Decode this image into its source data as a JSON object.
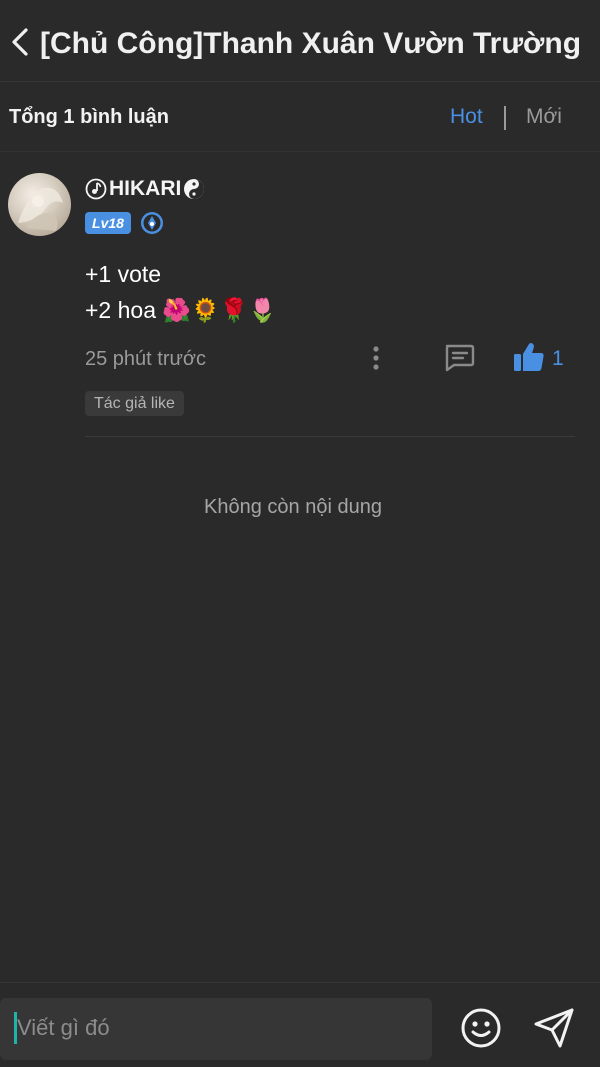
{
  "header": {
    "title": "[Chủ Công]Thanh Xuân Vườn Trường"
  },
  "filter": {
    "count_label": "Tổng 1 bình luận",
    "sort_hot": "Hot",
    "sort_new": "Mới",
    "active": "Hot"
  },
  "comment": {
    "username": "HIKARI",
    "username_prefix_icon": "music-disc-icon",
    "username_suffix_icon": "yin-yang-icon",
    "level": "Lv18",
    "role_icon": "shield-badge-icon",
    "line1": "+1 vote",
    "line2_text": "+2 hoa",
    "line2_emojis": "🌺🌻🌹🌷",
    "time": "25 phút trước",
    "like_count": "1",
    "author_liked": "Tác giả like",
    "liked": true
  },
  "list": {
    "end_message": "Không còn nội dung"
  },
  "composer": {
    "placeholder": "Viết gì đó"
  },
  "colors": {
    "background": "#2a2a2a",
    "accent": "#4a90e2",
    "muted_text": "#9a9a9a",
    "caret": "#1fb5a6"
  }
}
